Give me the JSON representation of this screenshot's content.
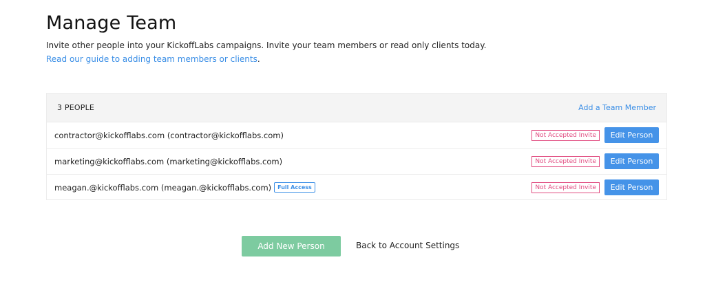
{
  "header": {
    "title": "Manage Team",
    "intro": "Invite other people into your KickoffLabs campaigns. Invite your team members or read only clients today.",
    "guide_link": "Read our guide to adding team members or clients",
    "guide_suffix": "."
  },
  "team": {
    "count_label": "3 PEOPLE",
    "add_member_label": "Add a Team Member",
    "people": [
      {
        "label": "contractor@kickofflabs.com (contractor@kickofflabs.com)",
        "access": "",
        "status": "Not Accepted Invite",
        "edit_label": "Edit Person"
      },
      {
        "label": "marketing@kickofflabs.com (marketing@kickofflabs.com)",
        "access": "",
        "status": "Not Accepted Invite",
        "edit_label": "Edit Person"
      },
      {
        "label": "meagan.@kickofflabs.com (meagan.@kickofflabs.com)",
        "access": "Full Access",
        "status": "Not Accepted Invite",
        "edit_label": "Edit Person"
      }
    ]
  },
  "footer": {
    "add_person_label": "Add New Person",
    "back_label": "Back to Account Settings"
  },
  "colors": {
    "link": "#3a8ee6",
    "primary_button": "#4593e8",
    "success_button": "#7dcba0",
    "invite_badge": "#e0487e",
    "panel_header": "#f4f4f4"
  }
}
